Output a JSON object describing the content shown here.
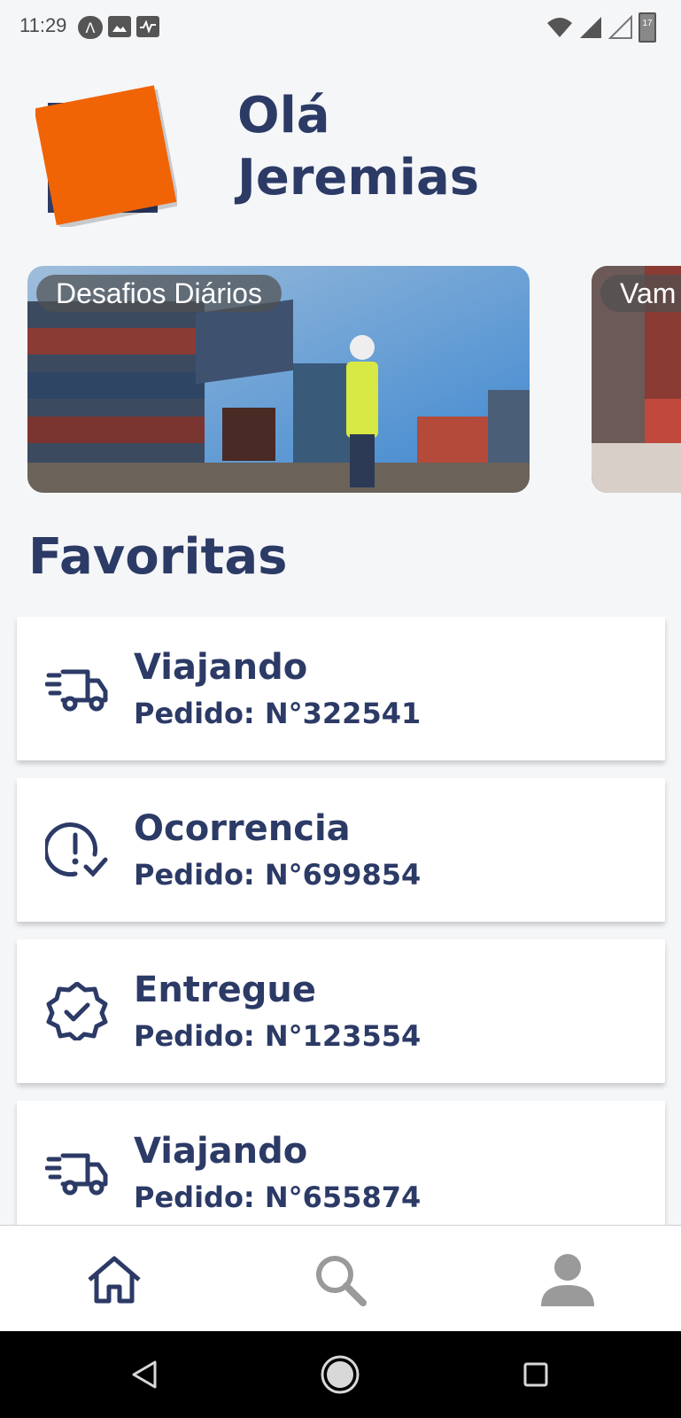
{
  "status_bar": {
    "time": "11:29",
    "battery_level": "17"
  },
  "header": {
    "greeting_line1": "Olá",
    "greeting_line2": "Jeremias"
  },
  "carousel": {
    "items": [
      {
        "label": "Desafios Diários"
      },
      {
        "label": "Vam"
      }
    ]
  },
  "favorites": {
    "title": "Favoritas",
    "items": [
      {
        "status": "Viajando",
        "order": "Pedido: N°322541",
        "icon": "truck-icon"
      },
      {
        "status": "Ocorrencia",
        "order": "Pedido: N°699854",
        "icon": "alert-check-icon"
      },
      {
        "status": "Entregue",
        "order": "Pedido: N°123554",
        "icon": "verified-badge-icon"
      },
      {
        "status": "Viajando",
        "order": "Pedido: N°655874",
        "icon": "truck-icon"
      }
    ]
  },
  "bottom_nav": {
    "items": [
      {
        "icon": "home-icon",
        "active": true
      },
      {
        "icon": "search-icon",
        "active": false
      },
      {
        "icon": "profile-icon",
        "active": false
      }
    ]
  },
  "colors": {
    "primary": "#2c3a66",
    "accent": "#f06406",
    "background": "#f5f6f8",
    "inactive": "#9a9a9a"
  }
}
